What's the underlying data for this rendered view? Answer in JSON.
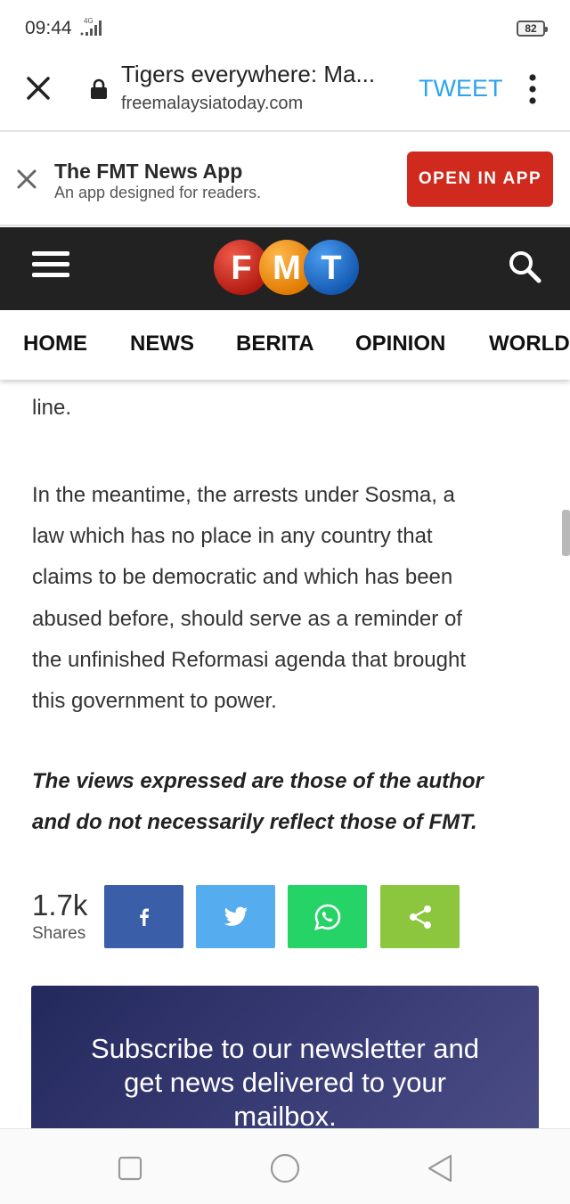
{
  "status_bar": {
    "time": "09:44",
    "network": "4G",
    "battery": "82"
  },
  "tab_bar": {
    "title": "Tigers everywhere: Ma...",
    "url": "freemalaysiatoday.com",
    "tweet_label": "TWEET"
  },
  "app_banner": {
    "title": "The FMT News App",
    "subtitle": "An app designed for readers.",
    "open_label": "OPEN IN APP"
  },
  "header": {
    "logo_letters": [
      "F",
      "M",
      "T"
    ],
    "colors": {
      "header_bg": "#222222",
      "logo_red": "#d0291d",
      "logo_orange": "#f39200",
      "logo_blue": "#1a6fd1"
    }
  },
  "nav": {
    "items": [
      "HOME",
      "NEWS",
      "BERITA",
      "OPINION",
      "WORLD"
    ]
  },
  "article": {
    "cut_line": "line.",
    "paragraph_lines": [
      "In the meantime, the arrests under Sosma, a",
      "law which has no place in any country that",
      "claims to be democratic and which has been",
      "abused before, should serve as a reminder of",
      "the unfinished Reformasi agenda that brought",
      "this government to power."
    ],
    "disclaimer_lines": [
      "The views expressed are those of the author",
      "and do not necessarily reflect those of FMT."
    ]
  },
  "share": {
    "count": "1.7k",
    "label": "Shares",
    "buttons": [
      {
        "name": "facebook",
        "color": "#3b5ea9"
      },
      {
        "name": "twitter",
        "color": "#55acee"
      },
      {
        "name": "whatsapp",
        "color": "#25d366"
      },
      {
        "name": "share",
        "color": "#8cc63f"
      }
    ]
  },
  "newsletter": {
    "text_lines": [
      "Subscribe to our newsletter and",
      "get news delivered to your",
      "mailbox."
    ]
  }
}
